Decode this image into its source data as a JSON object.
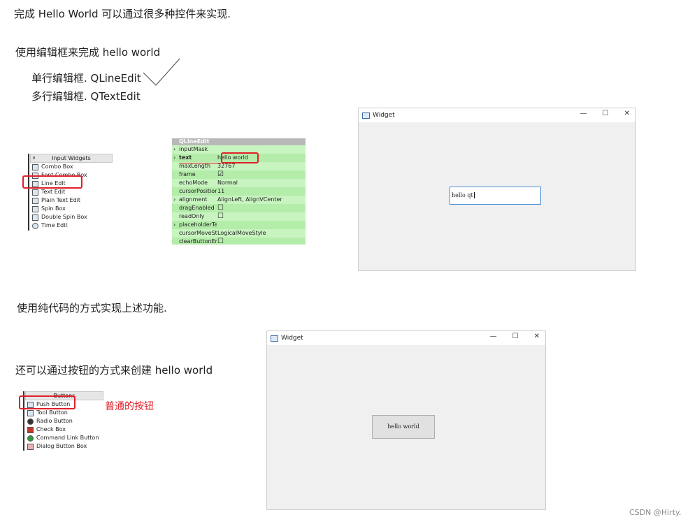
{
  "doc": {
    "line1": "完成 Hello World 可以通过很多种控件来实现.",
    "line2": "使用编辑框来完成 hello world",
    "line3": "单行编辑框. QLineEdit",
    "line4": "多行编辑框. QTextEdit",
    "line5": "使用纯代码的方式实现上述功能.",
    "line6": "还可以通过按钮的方式来创建 hello world",
    "button_note": "普通的按钮",
    "watermark": "CSDN @Hirty."
  },
  "input_widgets": {
    "header": "Input Widgets",
    "items": [
      "Combo Box",
      "Font Combo Box",
      "Line Edit",
      "Text Edit",
      "Plain Text Edit",
      "Spin Box",
      "Double Spin Box",
      "Time Edit"
    ]
  },
  "properties": {
    "header": "QLineEdit",
    "rows": [
      {
        "key": "inputMask",
        "value": "",
        "arrow": true
      },
      {
        "key": "text",
        "value": "hello world",
        "arrow": true,
        "bold": true
      },
      {
        "key": "maxLength",
        "value": "32767"
      },
      {
        "key": "frame",
        "value": "☑"
      },
      {
        "key": "echoMode",
        "value": "Normal"
      },
      {
        "key": "cursorPosition",
        "value": "11"
      },
      {
        "key": "alignment",
        "value": "AlignLeft, AlignVCenter",
        "arrow": true
      },
      {
        "key": "dragEnabled",
        "value": "☐"
      },
      {
        "key": "readOnly",
        "value": "☐"
      },
      {
        "key": "placeholderText",
        "value": "",
        "arrow": true
      },
      {
        "key": "cursorMoveStyle",
        "value": "LogicalMoveStyle"
      },
      {
        "key": "clearButtonEna...",
        "value": "☐"
      }
    ]
  },
  "window1": {
    "title": "Widget",
    "controls": [
      "—",
      "☐",
      "✕"
    ],
    "input_value": "hello qt"
  },
  "buttons_panel": {
    "header": "Buttons",
    "items": [
      "Push Button",
      "Tool Button",
      "Radio Button",
      "Check Box",
      "Command Link Button",
      "Dialog Button Box"
    ]
  },
  "window2": {
    "title": "Widget",
    "controls": [
      "—",
      "☐",
      "✕"
    ],
    "button_label": "hello world"
  }
}
